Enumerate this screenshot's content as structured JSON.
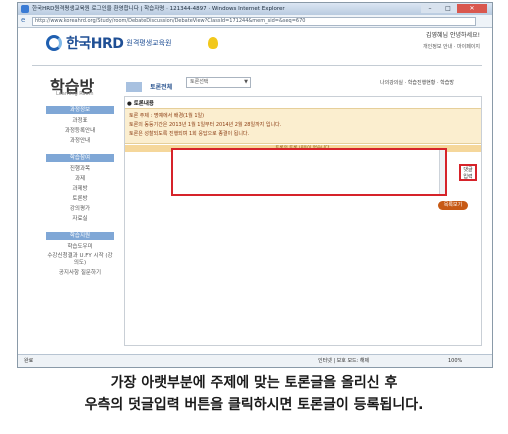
{
  "window": {
    "title": "한국HRD원격평생교육원 로그인을 환영합니다 | 학습자명 · 121344-4897 · Windows Internet Explorer",
    "controls": {
      "min": "–",
      "max": "□",
      "close": "✕"
    }
  },
  "address": {
    "url": "http://www.koreahrd.org/Study/room/DebateDiscussion/DebateView?ClassId=171244&mem_sid=&seq=670"
  },
  "site": {
    "logo": {
      "name": "한국HRD",
      "subtitle": "원격평생교육원"
    },
    "greeting": "김영혜님 안녕하세요!",
    "sub_links": "개인정보 안내 · 마이페이지"
  },
  "sidebar": {
    "title": "학습방",
    "subtitle": "Learning Room",
    "sections": [
      {
        "header": "과정정보",
        "items": [
          "과정표",
          "과정등록안내",
          "과정안내"
        ]
      },
      {
        "header": "학습참여",
        "items": [
          "진행과목",
          "과제",
          "과제방",
          "토론방",
          "강의평가",
          "자료실"
        ]
      },
      {
        "header": "학습지원",
        "items": [
          "학습도우미",
          "수강신청결과 U.FY 시작 (강의도)",
          "공지사항 질문하기"
        ]
      }
    ]
  },
  "content": {
    "section_label": "토론전체",
    "select_value": "토론선택 ",
    "right_links": "나의강의실 · 학습진행현황 · 학습방",
    "panel_title": "● 토론내용",
    "info_lines": [
      "토론 주제 : 명예에서 배경(1월 1일)",
      "토론의 동등기간은 2013년 1월 1일부터 2014년 2월 28일까지 입니다.",
      "토론은 성찰되도록 진행되며 1회 응답으로 종결이 됩니다."
    ],
    "info_bar": "토론의 토론 내용이 없습니다.",
    "submit_button": "댓글 입력",
    "list_button": "목록보기"
  },
  "statusbar": {
    "left": "완료",
    "middle": "인터넷 | 보호 모드: 해제",
    "right": "100%"
  },
  "caption": {
    "line1": "가장 아랫부분에 주제에 맞는 토론글을 올리신 후",
    "line2": "우측의 덧글입력 버튼을 클릭하시면 토론글이 등록됩니다."
  }
}
